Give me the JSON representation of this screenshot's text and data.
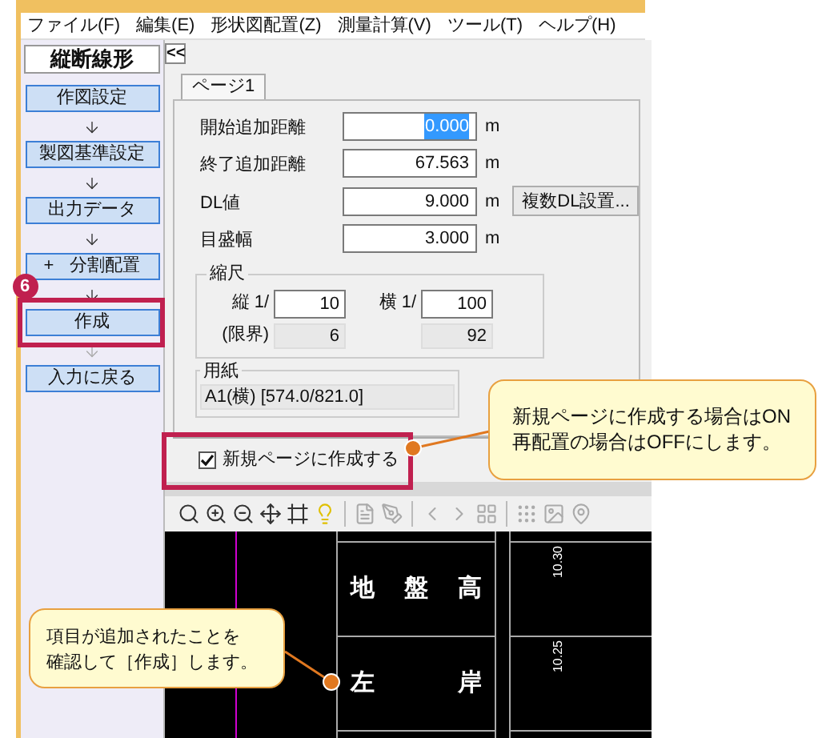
{
  "menu": [
    "ファイル(F)",
    "編集(E)",
    "形状図配置(Z)",
    "測量計算(V)",
    "ツール(T)",
    "ヘルプ(H)"
  ],
  "sidebar": {
    "title": "縦断線形",
    "collapse": "<<",
    "steps": [
      {
        "label": "作図設定",
        "highlighted": false
      },
      {
        "label": "製図基準設定",
        "highlighted": false
      },
      {
        "label": "出力データ",
        "highlighted": false
      },
      {
        "label": "分割配置",
        "prefix": "+",
        "highlighted": false
      },
      {
        "label": "作成",
        "highlighted": true,
        "badge": "6"
      },
      {
        "label": "入力に戻る",
        "highlighted": false
      }
    ]
  },
  "tab": {
    "label": "ページ1",
    "selected": true
  },
  "fields": [
    {
      "label": "開始追加距離",
      "value": "0.000",
      "unit": "m",
      "text_selected": true
    },
    {
      "label": "終了追加距離",
      "value": "67.563",
      "unit": "m",
      "text_selected": false
    },
    {
      "label": "DL値",
      "value": "9.000",
      "unit": "m",
      "text_selected": false,
      "button": "複数DL設置..."
    },
    {
      "label": "目盛幅",
      "value": "3.000",
      "unit": "m",
      "text_selected": false
    }
  ],
  "scale": {
    "title": "縮尺",
    "vertical_label": "縦 1/",
    "vertical": "10",
    "horizontal_label": "横 1/",
    "horizontal": "100",
    "limit_label": "(限界)",
    "vertical_limit": "6",
    "horizontal_limit": "92"
  },
  "paper": {
    "title": "用紙",
    "value": "A1(横) [574.0/821.0]"
  },
  "new_page": {
    "label": "新規ページに作成する",
    "checked": true,
    "highlighted": true
  },
  "toolbar": [
    {
      "kind": "zoom-fit",
      "disabled": false
    },
    {
      "kind": "zoom-in",
      "disabled": false
    },
    {
      "kind": "zoom-out",
      "disabled": false
    },
    {
      "kind": "move",
      "disabled": false
    },
    {
      "kind": "frame",
      "disabled": false
    },
    {
      "kind": "bulb",
      "disabled": false
    },
    {
      "kind": "sep"
    },
    {
      "kind": "page",
      "disabled": true
    },
    {
      "kind": "pen",
      "disabled": true
    },
    {
      "kind": "sep"
    },
    {
      "kind": "prev",
      "disabled": true
    },
    {
      "kind": "next",
      "disabled": true
    },
    {
      "kind": "layout",
      "disabled": true
    },
    {
      "kind": "sep"
    },
    {
      "kind": "points",
      "disabled": true
    },
    {
      "kind": "image",
      "disabled": true
    },
    {
      "kind": "search",
      "disabled": true
    }
  ],
  "drawing": {
    "rows": [
      {
        "chars": [
          "地",
          "盤",
          "高"
        ],
        "value": "10.30"
      },
      {
        "chars": [
          "左",
          "岸"
        ],
        "value": "10.25"
      }
    ]
  },
  "callouts": [
    {
      "lines": [
        "新規ページに作成する場合はON",
        "再配置の場合はOFFにします。"
      ]
    },
    {
      "lines": [
        "項目が追加されたことを",
        "確認して［作成］します。"
      ]
    }
  ]
}
